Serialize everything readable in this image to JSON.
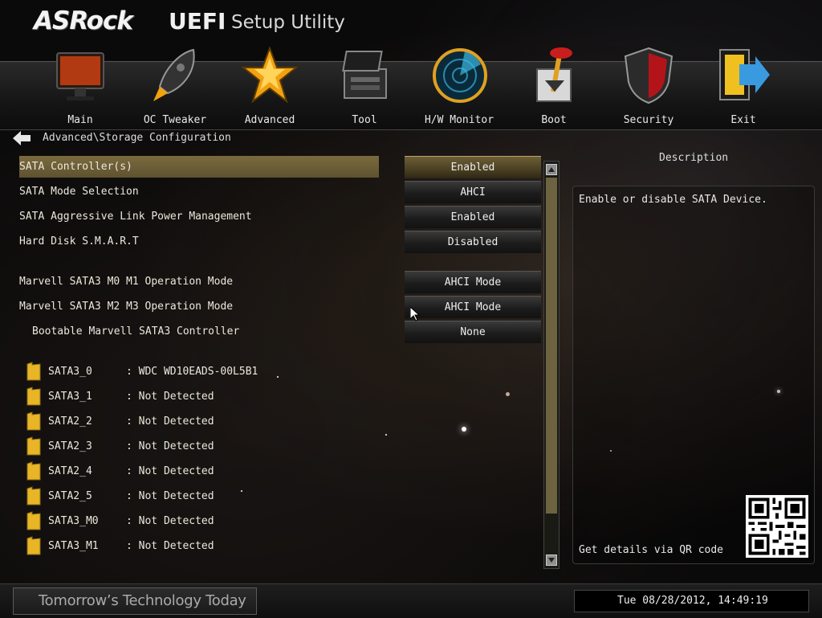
{
  "header": {
    "brand": "ASRock",
    "title_uefi": "UEFI",
    "title_setup": "Setup Utility"
  },
  "menu": [
    {
      "label": "Main",
      "icon": "monitor-icon"
    },
    {
      "label": "OC Tweaker",
      "icon": "rocket-icon"
    },
    {
      "label": "Advanced",
      "icon": "star-icon"
    },
    {
      "label": "Tool",
      "icon": "toolbox-icon"
    },
    {
      "label": "H/W Monitor",
      "icon": "radar-icon"
    },
    {
      "label": "Boot",
      "icon": "boot-lever-icon"
    },
    {
      "label": "Security",
      "icon": "shield-icon"
    },
    {
      "label": "Exit",
      "icon": "exit-icon"
    }
  ],
  "breadcrumb": "Advanced\\Storage Configuration",
  "settings": [
    {
      "label": "SATA Controller(s)",
      "value": "Enabled"
    },
    {
      "label": "SATA Mode Selection",
      "value": "AHCI"
    },
    {
      "label": "SATA Aggressive Link Power Management",
      "value": "Enabled"
    },
    {
      "label": "Hard Disk S.M.A.R.T",
      "value": "Disabled"
    },
    {
      "label": "Marvell SATA3 M0 M1 Operation Mode",
      "value": "AHCI Mode"
    },
    {
      "label": "Marvell SATA3 M2 M3 Operation Mode",
      "value": "AHCI Mode"
    },
    {
      "label": "Bootable Marvell SATA3 Controller",
      "value": "None"
    }
  ],
  "devices": [
    {
      "name": "SATA3_0",
      "value": ": WDC WD10EADS-00L5B1"
    },
    {
      "name": "SATA3_1",
      "value": ": Not Detected"
    },
    {
      "name": "SATA2_2",
      "value": ": Not Detected"
    },
    {
      "name": "SATA2_3",
      "value": ": Not Detected"
    },
    {
      "name": "SATA2_4",
      "value": ": Not Detected"
    },
    {
      "name": "SATA2_5",
      "value": ": Not Detected"
    },
    {
      "name": "SATA3_M0",
      "value": ": Not Detected"
    },
    {
      "name": "SATA3_M1",
      "value": ": Not Detected"
    }
  ],
  "description": {
    "title": "Description",
    "text": "Enable or disable SATA Device.",
    "qr_text": "Get details via QR code"
  },
  "footer": {
    "tagline": "Tomorrow’s Technology Today",
    "datetime": "Tue 08/28/2012, 14:49:19"
  },
  "colors": {
    "selection": "#6e603a",
    "scroll_thumb": "#6d6340",
    "background": "#0b0a0a"
  }
}
